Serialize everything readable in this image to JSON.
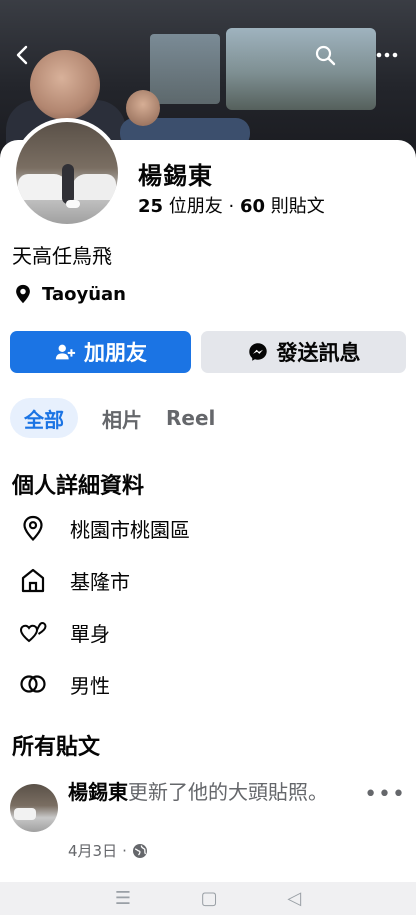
{
  "header": {
    "back_icon": "chevron-left-icon",
    "search_icon": "search-icon",
    "more_icon": "more-horizontal-icon"
  },
  "profile": {
    "name": "楊錫東",
    "friends_count": "25",
    "friends_label": "位朋友",
    "separator": "·",
    "posts_count": "60",
    "posts_label": "則貼文",
    "bio": "天高任鳥飛",
    "location": "Taoyüan"
  },
  "actions": {
    "add_friend": "加朋友",
    "message": "發送訊息"
  },
  "tabs": [
    "全部",
    "相片",
    "Reel"
  ],
  "details": {
    "title": "個人詳細資料",
    "items": [
      {
        "icon": "location-pin-icon",
        "text": "桃園市桃園區"
      },
      {
        "icon": "home-icon",
        "text": "基隆市"
      },
      {
        "icon": "hearts-icon",
        "text": "單身"
      },
      {
        "icon": "gender-icon",
        "text": "男性"
      }
    ]
  },
  "posts": {
    "title": "所有貼文",
    "author": "楊錫東",
    "action": "更新了他的大頭貼照。",
    "date": "4月3日",
    "dot": "·",
    "more": "•••"
  },
  "system_nav": {
    "menu": "☰",
    "home": "▢",
    "back": "◁"
  },
  "colors": {
    "accent": "#1b74e4",
    "secondary_button": "#e4e6eb",
    "muted_text": "#65676b"
  }
}
